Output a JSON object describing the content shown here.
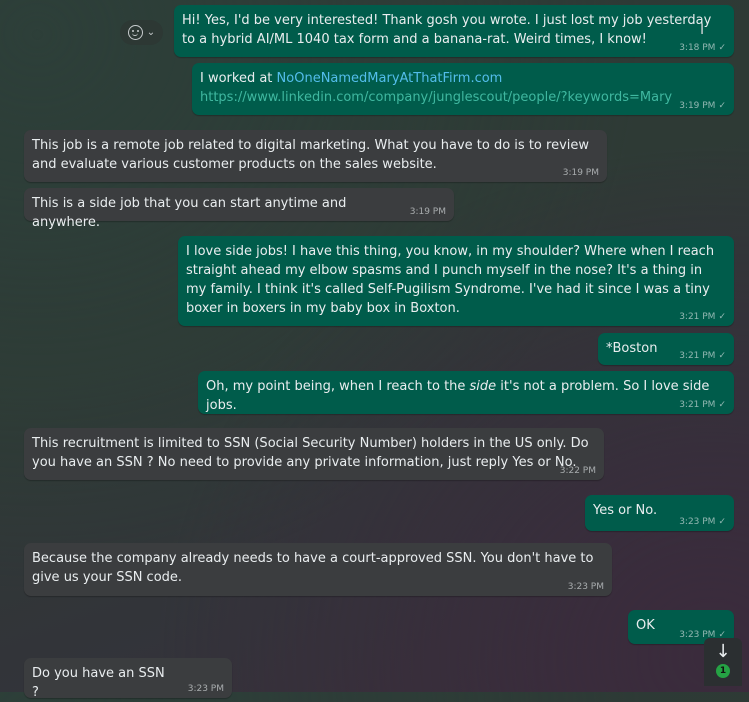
{
  "messages": [
    {
      "id": "m1",
      "dir": "out",
      "text": "Hi!  Yes, I'd be very interested!  Thank gosh you wrote.  I just lost my job yesterday to a hybrid AI/ML 1040 tax form and a banana-rat.  Weird times, I know!",
      "time": "3:18 PM"
    },
    {
      "id": "m2",
      "dir": "out",
      "prefix": "I worked at ",
      "link": "NoOneNamedMaryAtThatFirm.com",
      "url": "https://www.linkedin.com/company/junglescout/people/?keywords=Mary",
      "time": "3:19 PM"
    },
    {
      "id": "m3",
      "dir": "in",
      "text": "This job is a remote job related to digital marketing. What you have to do is to review and evaluate various customer products on the sales website.",
      "time": "3:19 PM"
    },
    {
      "id": "m4",
      "dir": "in",
      "text": "This is a side job that you can start anytime and anywhere.",
      "time": "3:19 PM"
    },
    {
      "id": "m5",
      "dir": "out",
      "text": "I love side jobs!  I have this thing, you know, in my shoulder?  Where when I reach straight ahead my elbow spasms and I punch myself in the nose?  It's a thing in my family.  I think it's called Self-Pugilism Syndrome.  I've had it since I was a tiny boxer in boxers in my baby box in Boxton.",
      "time": "3:21 PM"
    },
    {
      "id": "m6",
      "dir": "out",
      "text": "*Boston",
      "time": "3:21 PM"
    },
    {
      "id": "m7",
      "dir": "out",
      "before": "Oh, my point being, when I reach to the ",
      "em": "side",
      "after": " it's not a problem.  So I love side jobs.",
      "time": "3:21 PM"
    },
    {
      "id": "m8",
      "dir": "in",
      "text": "This recruitment is limited to SSN (Social Security Number) holders in the US only. Do you have an SSN ? No need to provide any private information, just reply Yes or No.",
      "time": "3:22 PM"
    },
    {
      "id": "m9",
      "dir": "out",
      "text": "Yes or No.",
      "time": "3:23 PM"
    },
    {
      "id": "m10",
      "dir": "in",
      "text": "Because the company already needs to have a court-approved SSN. You don't have to give us your SSN code.",
      "time": "3:23 PM"
    },
    {
      "id": "m11",
      "dir": "out",
      "text": "OK",
      "time": "3:23 PM"
    },
    {
      "id": "m12",
      "dir": "in",
      "text": "Do you have an SSN ?",
      "time": "3:23 PM"
    }
  ],
  "read_tick": "✓",
  "controls": {
    "emoji_icon": "smiley-icon",
    "emoji_chevron": "⌄",
    "scroll_arrow": "↓",
    "unread_count": "1"
  },
  "colors": {
    "outgoing_bubble": "#005c4b",
    "incoming_bubble": "#3b3d3f",
    "link": "#53bdeb",
    "badge": "#25a244"
  }
}
